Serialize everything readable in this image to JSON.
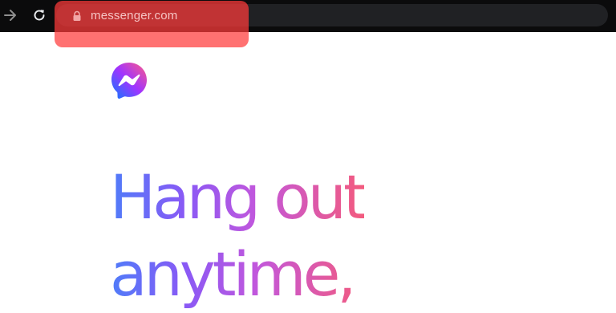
{
  "browser": {
    "url": "messenger.com",
    "icons": {
      "forward": "arrow-right-icon",
      "reload": "reload-icon",
      "lock": "lock-icon"
    },
    "highlight_color": "#ff3a3a"
  },
  "page": {
    "logo": "messenger-logo",
    "headline_line1": "Hang out",
    "headline_line2": "anytime,",
    "gradient_colors": [
      "#4f7cf9",
      "#8a59f5",
      "#c257dc",
      "#f35b7e"
    ]
  }
}
